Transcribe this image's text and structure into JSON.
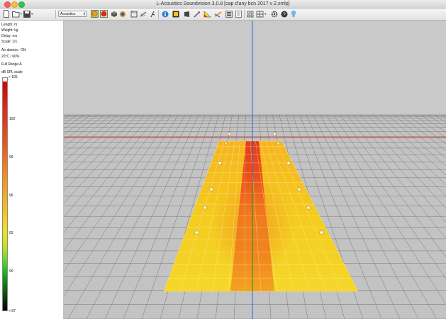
{
  "window": {
    "title": "L-Acoustics Soundvision 3.0.8 [cap d'any bcn 2017 v 2.xmlp]"
  },
  "toolbar": {
    "mode_select": "Acoustics",
    "icons": [
      "new-file-icon",
      "open-folder-icon",
      "save-icon",
      "spl-map-icon",
      "spl-map-2-icon",
      "3d-view-icon",
      "source-icon",
      "room-icon",
      "measure-icon",
      "rigging-icon",
      "info-icon",
      "report-icon",
      "box-icon",
      "pen-icon",
      "coverage-icon",
      "mapping-icon",
      "export-icon",
      "grid-icon",
      "layout-icon",
      "settings-icon",
      "help-icon",
      "tip-icon"
    ]
  },
  "sidebar": {
    "length": "Length: m",
    "weight": "Weight: kg",
    "delay": "Delay: ms",
    "scale": "Scale: 1/1",
    "air": "Air absorp.: ON",
    "temp": "20°C / 60%",
    "range": "Full Range A",
    "legend_title": "dB SPL scale",
    "ticks": {
      "top": "> 105",
      "t102": "102",
      "t99": "99",
      "t96": "96",
      "t93": "93",
      "t90": "90",
      "bottom": "< 87"
    }
  },
  "colors": {
    "spl_high": "#e4261a",
    "spl_mid": "#f39a1e",
    "spl_low": "#f4e021",
    "axis_blue": "#2a66d6",
    "axis_red": "#d63a2a",
    "axis_green": "#2a9a2a"
  }
}
